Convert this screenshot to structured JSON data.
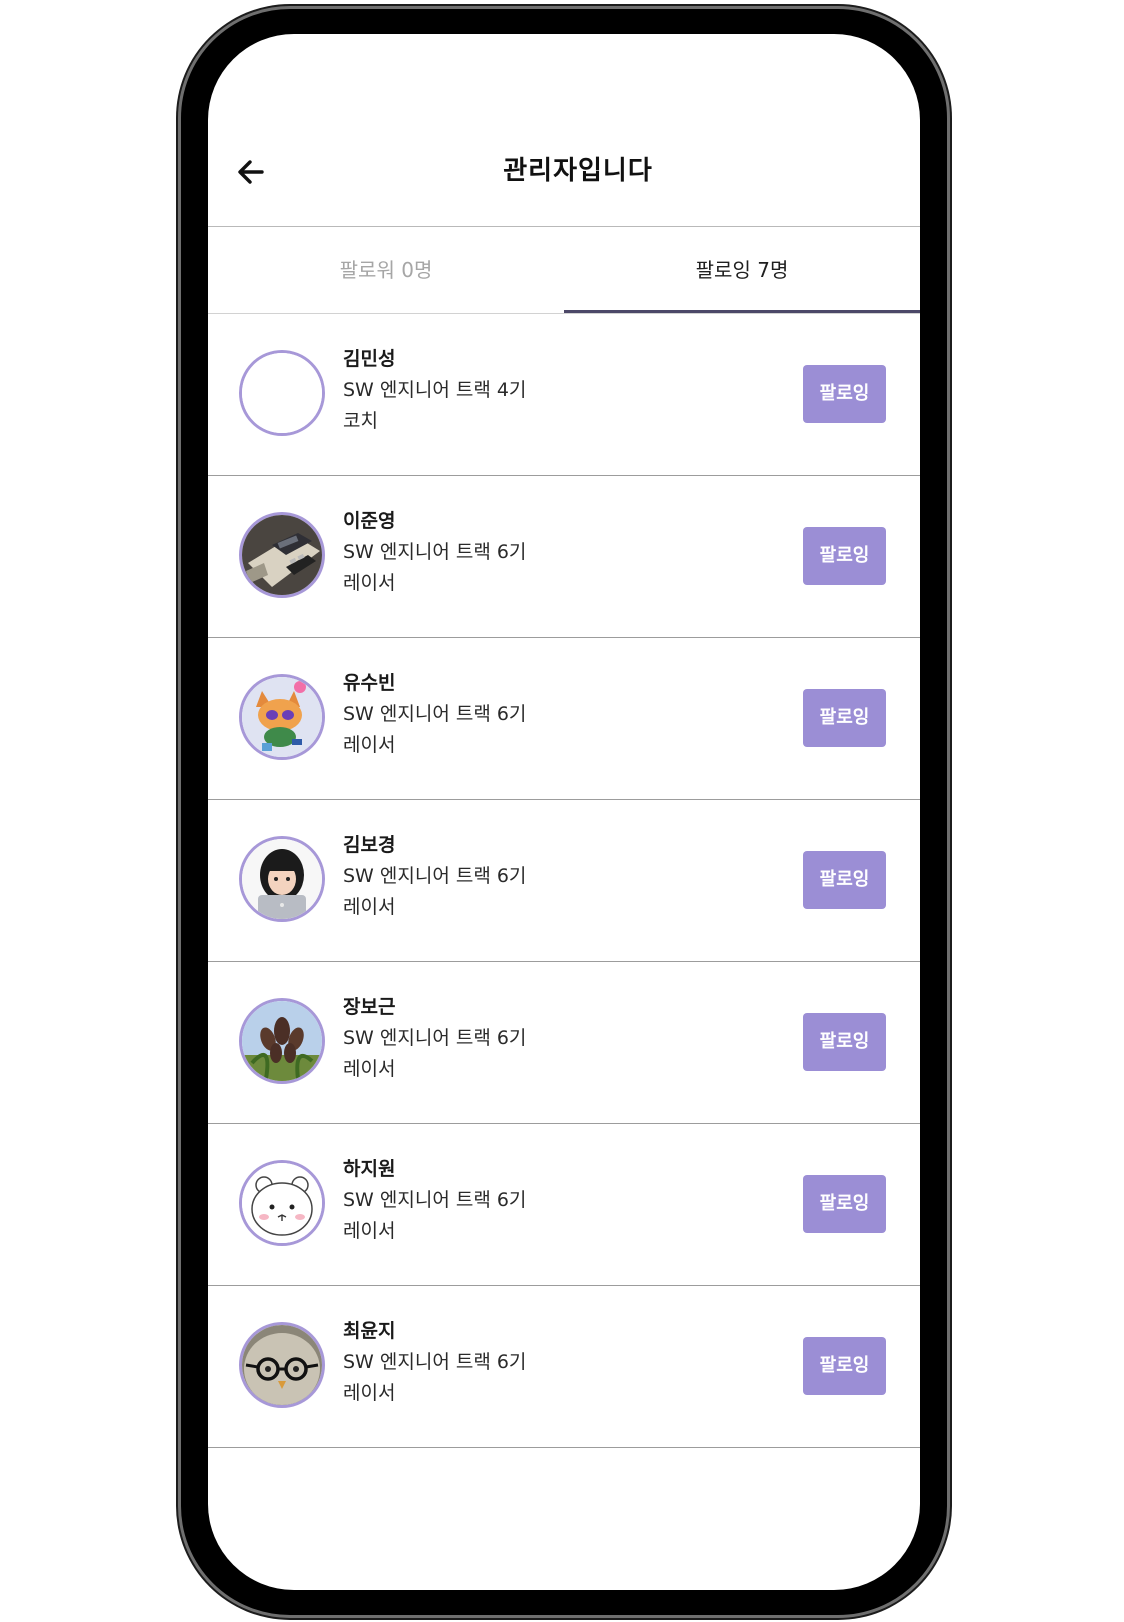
{
  "header": {
    "title": "관리자입니다",
    "back_icon": "arrow-left-icon"
  },
  "tabs": [
    {
      "label": "팔로워 0명",
      "active": false
    },
    {
      "label": "팔로잉 7명",
      "active": true
    }
  ],
  "colors": {
    "accent": "#9b8ed5",
    "avatar_border": "#a798d8",
    "tab_indicator": "#4c4868",
    "inactive_tab_text": "#a6a6a6"
  },
  "following": [
    {
      "name": "김민성",
      "track": "SW 엔지니어 트랙 4기",
      "role": "코치",
      "avatar": "empty-avatar",
      "button": "팔로잉"
    },
    {
      "name": "이준영",
      "track": "SW 엔지니어 트랙 6기",
      "role": "레이서",
      "avatar": "keyboard-photo-avatar",
      "button": "팔로잉"
    },
    {
      "name": "유수빈",
      "track": "SW 엔지니어 트랙 6기",
      "role": "레이서",
      "avatar": "cartoon-character-avatar",
      "button": "팔로잉"
    },
    {
      "name": "김보경",
      "track": "SW 엔지니어 트랙 6기",
      "role": "레이서",
      "avatar": "person-with-laptop-avatar",
      "button": "팔로잉"
    },
    {
      "name": "장보근",
      "track": "SW 엔지니어 트랙 6기",
      "role": "레이서",
      "avatar": "plant-photo-avatar",
      "button": "팔로잉"
    },
    {
      "name": "하지원",
      "track": "SW 엔지니어 트랙 6기",
      "role": "레이서",
      "avatar": "white-bear-drawing-avatar",
      "button": "팔로잉"
    },
    {
      "name": "최윤지",
      "track": "SW 엔지니어 트랙 6기",
      "role": "레이서",
      "avatar": "bird-with-glasses-avatar",
      "button": "팔로잉"
    }
  ]
}
